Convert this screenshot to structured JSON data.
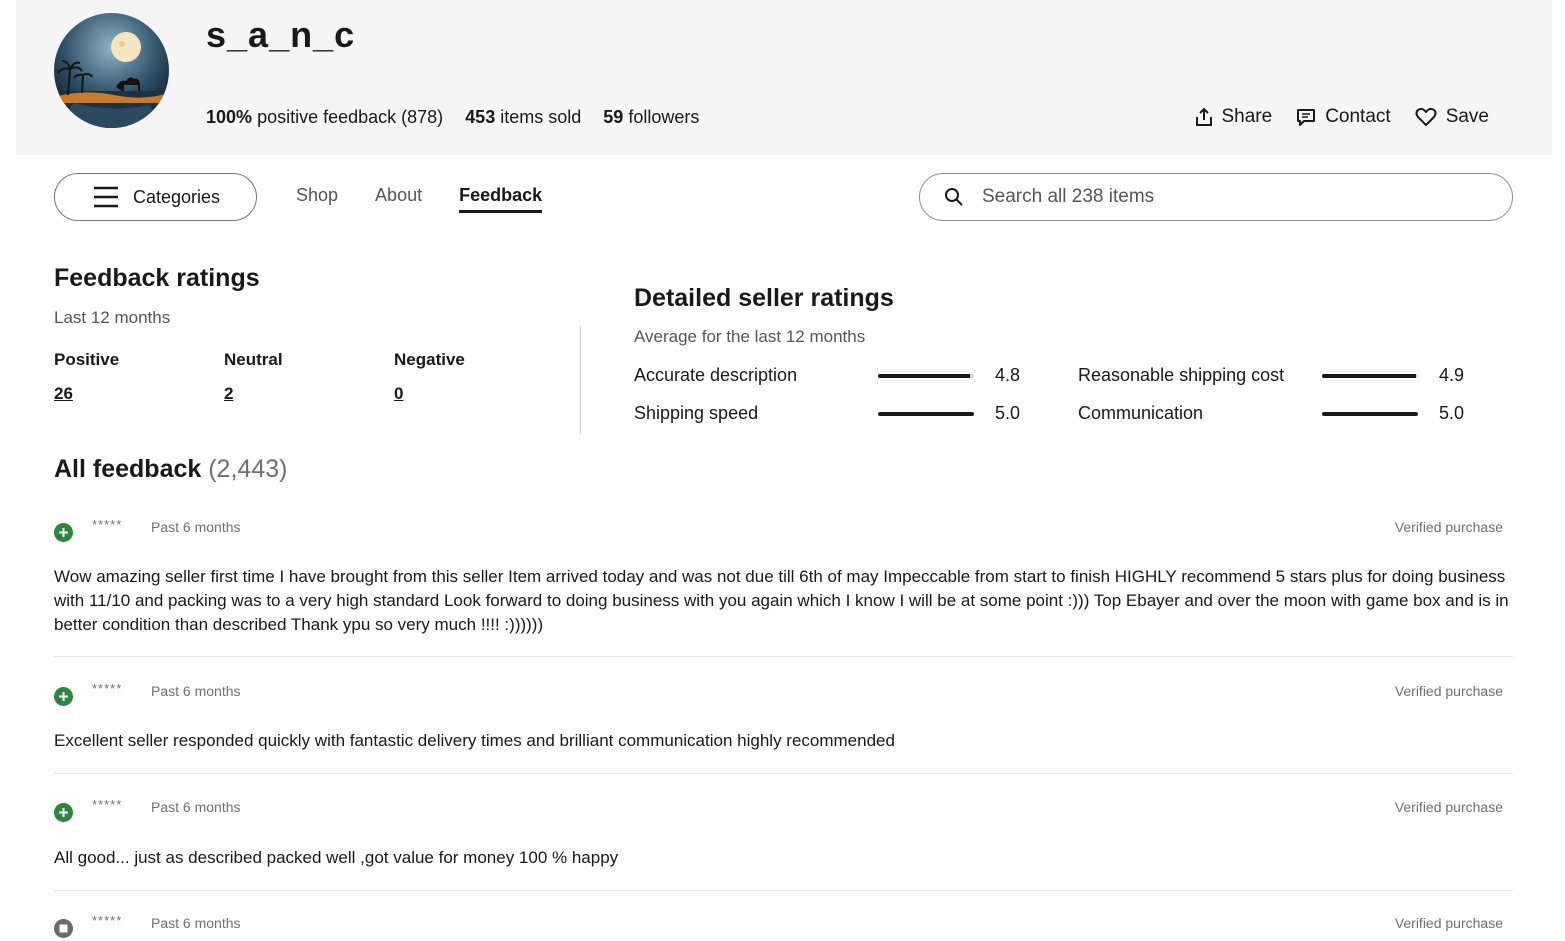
{
  "store": {
    "name": "s_a_n_c",
    "positive_pct": "100%",
    "positive_text": "positive feedback (878)",
    "items_sold": "453",
    "items_sold_text": "items sold",
    "followers": "59",
    "followers_text": "followers"
  },
  "header_actions": {
    "share": "Share",
    "contact": "Contact",
    "save": "Save"
  },
  "nav": {
    "categories": "Categories",
    "tabs": [
      {
        "label": "Shop",
        "active": false
      },
      {
        "label": "About",
        "active": false
      },
      {
        "label": "Feedback",
        "active": true
      }
    ],
    "search_placeholder": "Search all 238 items"
  },
  "feedback_ratings": {
    "title": "Feedback ratings",
    "period": "Last 12 months",
    "positive_label": "Positive",
    "positive": "26",
    "neutral_label": "Neutral",
    "neutral": "2",
    "negative_label": "Negative",
    "negative": "0"
  },
  "detailed_ratings": {
    "title": "Detailed seller ratings",
    "subtitle": "Average for the last 12 months",
    "max": 5,
    "items": [
      {
        "name": "Accurate description",
        "score": "4.8",
        "value": 4.8
      },
      {
        "name": "Reasonable shipping cost",
        "score": "4.9",
        "value": 4.9
      },
      {
        "name": "Shipping speed",
        "score": "5.0",
        "value": 5.0
      },
      {
        "name": "Communication",
        "score": "5.0",
        "value": 5.0
      }
    ]
  },
  "all_feedback": {
    "title": "All feedback",
    "count": "(2,443)",
    "items": [
      {
        "type": "positive",
        "user": "*****",
        "when": "Past 6 months",
        "verified": "Verified purchase",
        "comment": "Wow amazing seller first time I have brought from this seller Item arrived today and was not due till 6th of may Impeccable from start to finish HIGHLY recommend 5 stars plus for doing business with 11/10 and packing was to a very high standard Look forward to doing business with you again which I know I will be at some point :))) Top Ebayer and over the moon with game box and is in better condition than described Thank ypu so very much !!!! :))))))"
      },
      {
        "type": "positive",
        "user": "*****",
        "when": "Past 6 months",
        "verified": "Verified purchase",
        "comment": "Excellent seller responded quickly with fantastic delivery times and brilliant communication highly recommended"
      },
      {
        "type": "positive",
        "user": "*****",
        "when": "Past 6 months",
        "verified": "Verified purchase",
        "comment": "All good... just as described packed well ,got value for money 100 % happy"
      },
      {
        "type": "neutral",
        "user": "*****",
        "when": "Past 6 months",
        "verified": "Verified purchase",
        "comment": ""
      }
    ]
  },
  "colors": {
    "positive": "#2e8540",
    "neutral": "#6b6b6b",
    "header_bg": "#f5f5f5"
  }
}
